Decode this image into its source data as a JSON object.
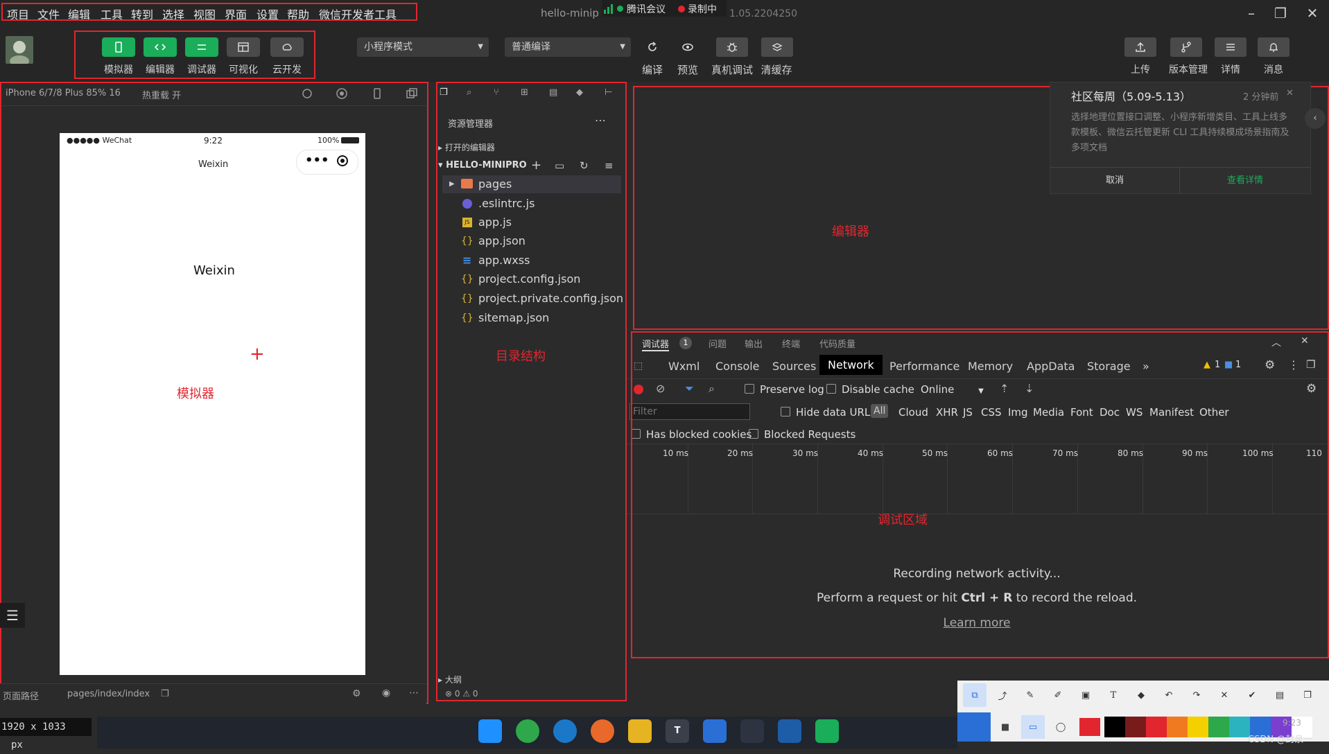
{
  "menubar": {
    "items": [
      "项目",
      "文件",
      "编辑",
      "工具",
      "转到",
      "选择",
      "视图",
      "界面",
      "设置",
      "帮助",
      "微信开发者工具"
    ],
    "title": "hello-minip",
    "meeting": "腾讯会议",
    "recording": "录制中",
    "version": "1.05.2204250"
  },
  "toolbar": {
    "buttons": [
      "模拟器",
      "编辑器",
      "调试器",
      "可视化",
      "云开发"
    ],
    "mode_select": "小程序模式",
    "compile_select": "普通编译",
    "actions": [
      "编译",
      "预览",
      "真机调试",
      "清缓存"
    ],
    "right_actions": [
      "上传",
      "版本管理",
      "详情",
      "消息"
    ]
  },
  "simulator": {
    "device": "iPhone 6/7/8 Plus 85% 16",
    "hot_reload": "热重载 开",
    "carrier": "●●●●● WeChat",
    "time": "9:22",
    "battery": "100%",
    "nav_title": "Weixin",
    "body_text": "Weixin",
    "page_path_label": "页面路径",
    "page_path": "pages/index/index",
    "label": "模拟器"
  },
  "explorer": {
    "title": "资源管理器",
    "open_editors": "打开的编辑器",
    "project": "HELLO-MINIPRO",
    "files": [
      {
        "name": "pages",
        "icon": "folder"
      },
      {
        "name": ".eslintrc.js",
        "icon": "eslint"
      },
      {
        "name": "app.js",
        "icon": "js"
      },
      {
        "name": "app.json",
        "icon": "json"
      },
      {
        "name": "app.wxss",
        "icon": "wxss"
      },
      {
        "name": "project.config.json",
        "icon": "json"
      },
      {
        "name": "project.private.config.json",
        "icon": "json"
      },
      {
        "name": "sitemap.json",
        "icon": "json"
      }
    ],
    "outline": "大纲",
    "status": "⊗ 0 ⚠ 0",
    "label": "目录结构"
  },
  "editor": {
    "label": "编辑器"
  },
  "notification": {
    "title": "社区每周（5.09-5.13）",
    "time": "2 分钟前",
    "body": "选择地理位置接口调整、小程序新增类目、工具上线多款模板、微信云托管更新 CLI 工具持续模成场景指南及多项文档",
    "cancel": "取消",
    "details": "查看详情"
  },
  "devtools": {
    "top_tabs": [
      "调试器",
      "问题",
      "输出",
      "终端",
      "代码质量"
    ],
    "badge": "1",
    "tabs": [
      "Wxml",
      "Console",
      "Sources",
      "Network",
      "Performance",
      "Memory",
      "AppData",
      "Storage"
    ],
    "more": "»",
    "warn_count": "1",
    "info_count": "1",
    "preserve_log": "Preserve log",
    "disable_cache": "Disable cache",
    "throttle": "Online",
    "filter_placeholder": "Filter",
    "hide_data_urls": "Hide data URLs",
    "types": [
      "All",
      "Cloud",
      "XHR",
      "JS",
      "CSS",
      "Img",
      "Media",
      "Font",
      "Doc",
      "WS",
      "Manifest",
      "Other"
    ],
    "blocked_cookies": "Has blocked cookies",
    "blocked_requests": "Blocked Requests",
    "ticks": [
      "10 ms",
      "20 ms",
      "30 ms",
      "40 ms",
      "50 ms",
      "60 ms",
      "70 ms",
      "80 ms",
      "90 ms",
      "100 ms",
      "110"
    ],
    "recording_text": "Recording network activity...",
    "hint_prefix": "Perform a request or hit ",
    "hint_key": "Ctrl + R",
    "hint_suffix": " to record the reload.",
    "learn_more": "Learn more",
    "label": "调试区域"
  },
  "statusbar": {
    "resolution": "1920 x 1033",
    "unit": "px"
  },
  "taskbar": {
    "time": "9:23",
    "watermark": "CSDN @封泉一"
  },
  "colors": {
    "accent_green": "#1aad5a",
    "annotation_red": "#e2262f",
    "bg": "#2b2b2b"
  }
}
